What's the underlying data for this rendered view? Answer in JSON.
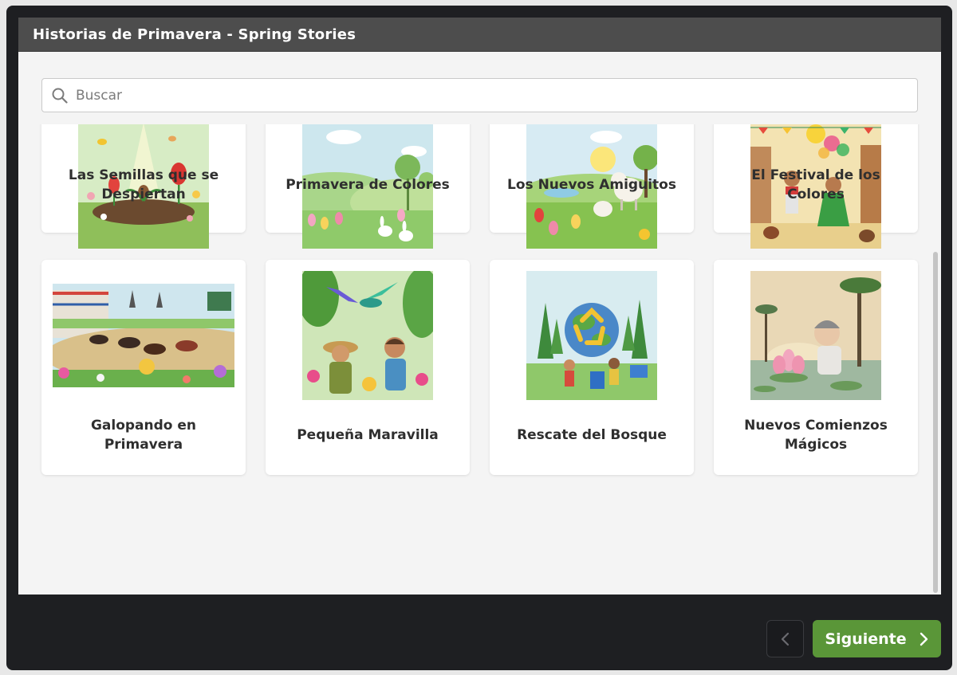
{
  "window": {
    "title": "Historias de Primavera - Spring Stories"
  },
  "search": {
    "placeholder": "Buscar",
    "value": ""
  },
  "stories": [
    {
      "title": "Las Semillas que se Despiertan"
    },
    {
      "title": "Primavera de Colores"
    },
    {
      "title": "Los Nuevos Amiguitos"
    },
    {
      "title": "El Festival de los Colores"
    },
    {
      "title": "Galopando en Primavera"
    },
    {
      "title": "Pequeña Maravilla"
    },
    {
      "title": "Rescate del Bosque"
    },
    {
      "title": "Nuevos Comienzos Mágicos"
    }
  ],
  "nav": {
    "next_label": "Siguiente"
  },
  "colors": {
    "accent": "#5a9638",
    "titlebar": "#4d4d4d",
    "frame": "#1e1f22"
  }
}
